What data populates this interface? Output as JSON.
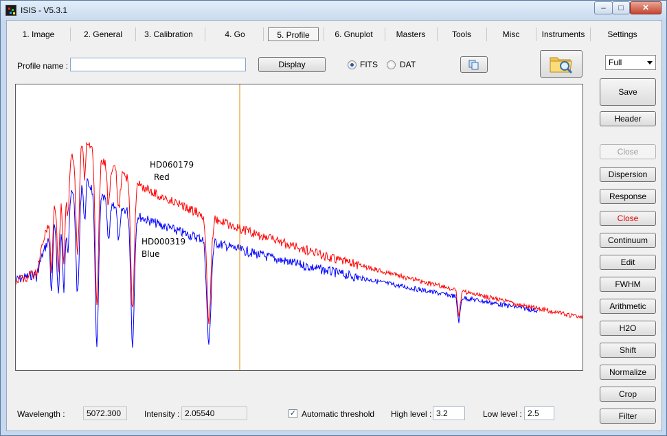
{
  "window": {
    "title": "ISIS - V5.3.1",
    "min_glyph": "–",
    "max_glyph": "□",
    "close_glyph": "✕"
  },
  "tabs": [
    {
      "label": "1. Image"
    },
    {
      "label": "2. General"
    },
    {
      "label": "3. Calibration"
    },
    {
      "label": "4. Go"
    },
    {
      "label": "5. Profile"
    },
    {
      "label": "6. Gnuplot"
    },
    {
      "label": "Masters"
    },
    {
      "label": "Tools"
    },
    {
      "label": "Misc"
    },
    {
      "label": "Instruments"
    },
    {
      "label": "Settings"
    }
  ],
  "profile": {
    "name_label": "Profile name :",
    "name_value": "",
    "display_label": "Display",
    "fits_label": "FITS",
    "dat_label": "DAT",
    "format_selected": "FITS"
  },
  "zoom_select": {
    "value": "Full"
  },
  "side_buttons": [
    {
      "label": "Save",
      "state": "normal"
    },
    {
      "label": "Header",
      "state": "normal"
    },
    {
      "label": "Close",
      "state": "disabled"
    },
    {
      "label": "Dispersion",
      "state": "normal"
    },
    {
      "label": "Response",
      "state": "normal"
    },
    {
      "label": "Close",
      "state": "red"
    },
    {
      "label": "Continuum",
      "state": "normal"
    },
    {
      "label": "Edit",
      "state": "normal"
    },
    {
      "label": "FWHM",
      "state": "normal"
    },
    {
      "label": "Arithmetic",
      "state": "normal"
    },
    {
      "label": "H2O",
      "state": "normal"
    },
    {
      "label": "Shift",
      "state": "normal"
    },
    {
      "label": "Normalize",
      "state": "normal"
    },
    {
      "label": "Crop",
      "state": "normal"
    },
    {
      "label": "Filter",
      "state": "normal"
    }
  ],
  "status": {
    "wavelength_label": "Wavelength :",
    "wavelength_value": "5072.300",
    "intensity_label": "Intensity :",
    "intensity_value": "2.05540",
    "auto_threshold_label": "Automatic threshold",
    "auto_threshold_checked": true,
    "high_level_label": "High level :",
    "high_level_value": "3.2",
    "low_level_label": "Low level :",
    "low_level_value": "2.5"
  },
  "chart_data": {
    "type": "line",
    "title": "",
    "xlabel": "",
    "ylabel": "",
    "annotations": [
      {
        "text": "HD060179",
        "series": "Red"
      },
      {
        "text": "Red",
        "series": "Red"
      },
      {
        "text": "HD000319",
        "series": "Blue"
      },
      {
        "text": "Blue",
        "series": "Blue"
      }
    ],
    "cursor_color": "#e08a00",
    "series": [
      {
        "color": "#ff0000"
      },
      {
        "color": "#0000ff"
      }
    ]
  }
}
